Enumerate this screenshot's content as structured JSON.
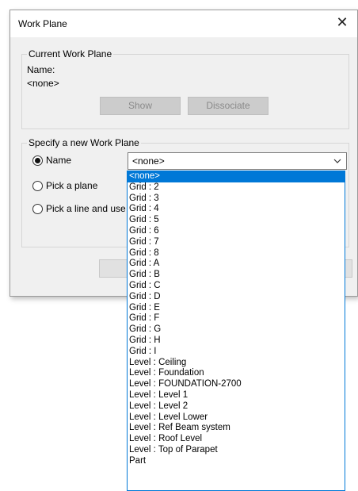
{
  "dialog": {
    "title": "Work Plane",
    "close_glyph": "✕"
  },
  "current_group": {
    "legend": "Current Work Plane",
    "name_label": "Name:",
    "name_value": "<none>",
    "show_label": "Show",
    "dissociate_label": "Dissociate"
  },
  "new_group": {
    "legend": "Specify a new Work Plane",
    "options": [
      {
        "label": "Name",
        "checked": true
      },
      {
        "label": "Pick a plane",
        "checked": false
      },
      {
        "label": "Pick a line and use",
        "checked": false
      }
    ],
    "combo_value": "<none>",
    "combo_icon": "chevron-down-icon"
  },
  "dropdown": {
    "items": [
      "<none>",
      "Grid : 2",
      "Grid : 3",
      "Grid : 4",
      "Grid : 5",
      "Grid : 6",
      "Grid : 7",
      "Grid : 8",
      "Grid : A",
      "Grid : B",
      "Grid : C",
      "Grid : D",
      "Grid : E",
      "Grid : F",
      "Grid : G",
      "Grid : H",
      "Grid : I",
      "Level : Ceiling",
      "Level : Foundation",
      "Level : FOUNDATION-2700",
      "Level : Level 1",
      "Level : Level 2",
      "Level : Level Lower",
      "Level : Ref Beam system",
      "Level : Roof Level",
      "Level : Top of Parapet",
      "Part"
    ],
    "selected_index": 0,
    "accent_color": "#0078d7"
  }
}
